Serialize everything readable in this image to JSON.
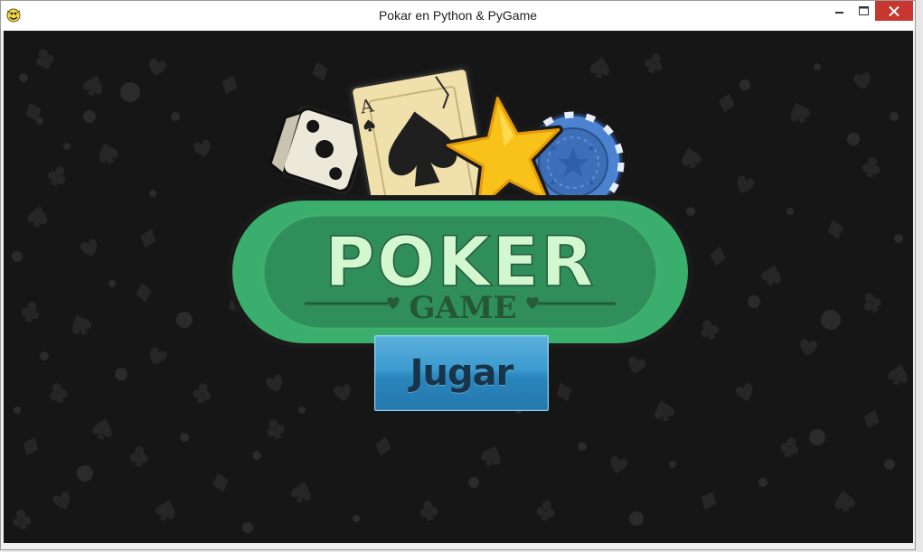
{
  "window": {
    "title": "Pokar en Python & PyGame",
    "app_icon": "pygame-snake-icon",
    "controls": [
      "minimize-icon",
      "maximize-icon",
      "close-icon"
    ]
  },
  "logo": {
    "title": "POKER",
    "subtitle": "GAME",
    "card_rank": "A",
    "decor": [
      "dice-icon",
      "ace-of-spades-card",
      "star-icon",
      "poker-chip-icon",
      "heart-icon"
    ]
  },
  "menu": {
    "play_label": "Jugar"
  },
  "colors": {
    "background": "#161616",
    "pattern": "#262626",
    "logo_green": "#3aae6c",
    "logo_green_dark": "#2f7e52",
    "logo_text": "#d3f7cf",
    "button_blue": "#3c9bd0",
    "button_text": "#18344a",
    "star": "#f8c21b",
    "chip": "#4b83d1",
    "close_red": "#c7372f"
  }
}
